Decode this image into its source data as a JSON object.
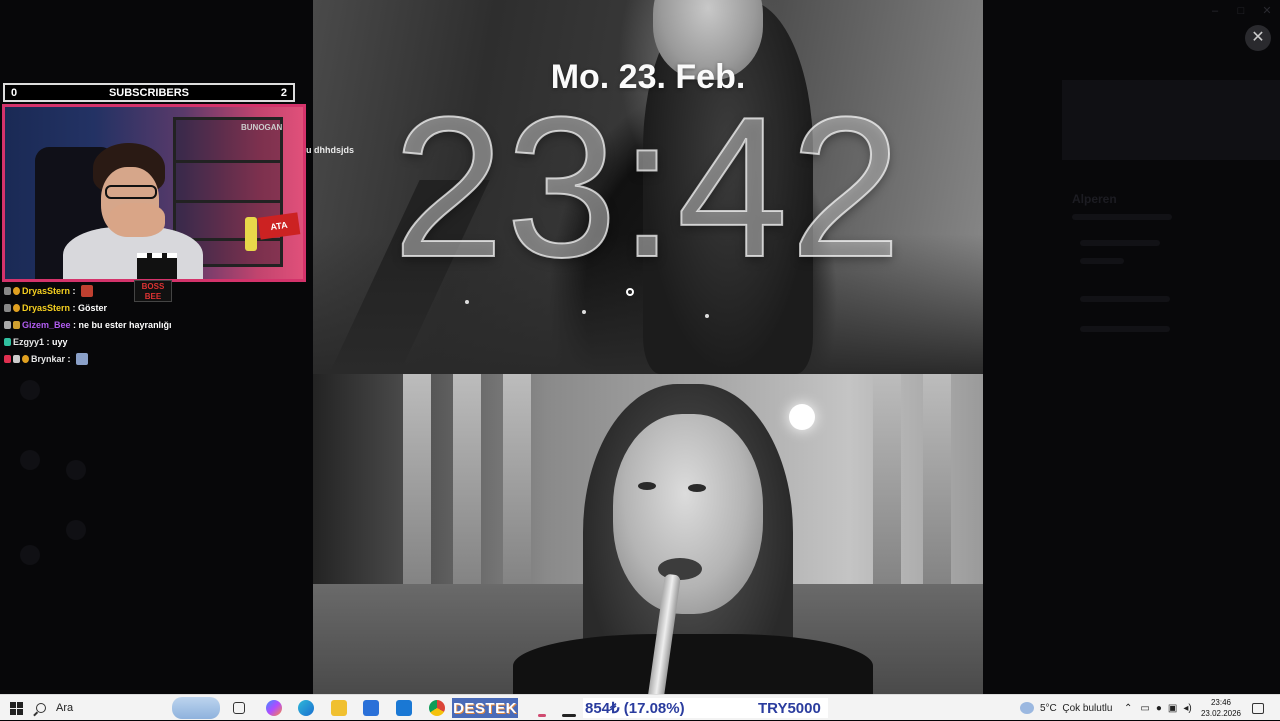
{
  "lockscreen": {
    "date": "Mo. 23. Feb.",
    "time": "23:42"
  },
  "overlay": {
    "close_symbol": "✕"
  },
  "subscriber_bar": {
    "left_value": "0",
    "label": "SUBSCRIBERS",
    "right_value": "2"
  },
  "webcam": {
    "boss_badge_line1": "BOSS",
    "boss_badge_line2": "BEE",
    "ata_sign": "ATA"
  },
  "floating_message": "u dhhdsjds",
  "chat": {
    "messages": [
      {
        "user": "DryasStern",
        "user_color": "#f5d020",
        "text": "",
        "emote_color": "#c04030"
      },
      {
        "user": "DryasStern",
        "user_color": "#f5d020",
        "text": "Göster"
      },
      {
        "user": "Gizem_Bee",
        "user_color": "#b05cf0",
        "text": "ne bu ester hayranlığı"
      },
      {
        "user": "Ezgyy1",
        "user_color": "#e6e6e6",
        "text": "uyy"
      },
      {
        "user": "Brynkar",
        "user_color": "#e6e6e6",
        "text": "",
        "emote_color": "#8aa0c8"
      }
    ]
  },
  "desktop_ghost": {
    "name": "Alperen"
  },
  "taskbar": {
    "search_label": "Ara",
    "destek_label": "DESTEK",
    "price_change": "854₺ (17.08%)",
    "price_target": "TRY5000",
    "weather_temp": "5°C",
    "weather_desc": "Çok bulutlu",
    "time": "23:46",
    "date": "23.02.2026"
  },
  "colors": {
    "cam_border": "#d4336b",
    "taskbar_bg": "#f3f3f3",
    "price_text": "#2a3c9e",
    "destek_bg": "#4a6bb8"
  }
}
